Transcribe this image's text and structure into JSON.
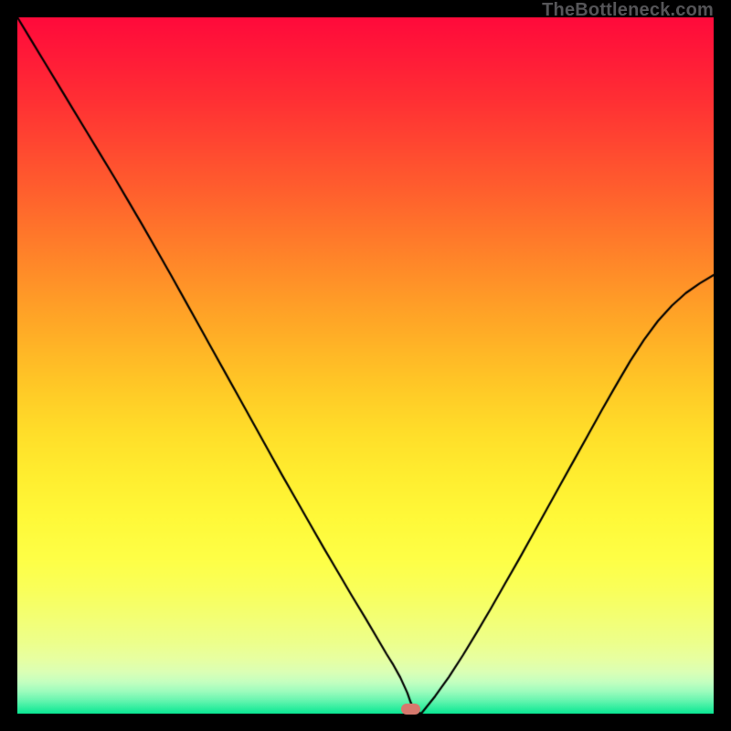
{
  "watermark": "TheBottleneck.com",
  "chart_data": {
    "type": "line",
    "title": "",
    "xlabel": "",
    "ylabel": "",
    "xlim": [
      0,
      100
    ],
    "ylim": [
      0,
      100
    ],
    "x": [
      0,
      2,
      4,
      6,
      8,
      10,
      12,
      14,
      16,
      18,
      20,
      22,
      24,
      26,
      28,
      30,
      32,
      34,
      36,
      38,
      40,
      42,
      44,
      46,
      48,
      50,
      52,
      53,
      54,
      55,
      56,
      56.5,
      57,
      58,
      60,
      62,
      64,
      66,
      68,
      70,
      72,
      74,
      76,
      78,
      80,
      82,
      84,
      86,
      88,
      90,
      92,
      94,
      96,
      98,
      100
    ],
    "values": [
      100,
      96.7,
      93.4,
      90.1,
      86.8,
      83.5,
      80.2,
      76.9,
      73.5,
      70.1,
      66.6,
      63.1,
      59.5,
      55.9,
      52.3,
      48.7,
      45.1,
      41.5,
      37.9,
      34.3,
      30.8,
      27.3,
      23.8,
      20.4,
      17.0,
      13.7,
      10.3,
      8.6,
      7.0,
      5.2,
      3.0,
      1.6,
      0.5,
      0,
      2.5,
      5.3,
      8.4,
      11.7,
      15.1,
      18.6,
      22.1,
      25.7,
      29.3,
      32.9,
      36.5,
      40.1,
      43.7,
      47.2,
      50.6,
      53.7,
      56.4,
      58.6,
      60.4,
      61.8,
      63.0
    ],
    "annotations": [
      {
        "type": "marker",
        "x_center": 56.5,
        "y": 0,
        "width_pct": 2.8,
        "color": "#d6786d"
      }
    ],
    "background_gradient": {
      "stops": [
        {
          "pos": 0.0,
          "color": "#ff0a3b"
        },
        {
          "pos": 0.06,
          "color": "#ff1c38"
        },
        {
          "pos": 0.12,
          "color": "#ff3034"
        },
        {
          "pos": 0.18,
          "color": "#ff4631"
        },
        {
          "pos": 0.24,
          "color": "#ff5c2e"
        },
        {
          "pos": 0.3,
          "color": "#ff732b"
        },
        {
          "pos": 0.36,
          "color": "#ff8a29"
        },
        {
          "pos": 0.42,
          "color": "#ffa127"
        },
        {
          "pos": 0.48,
          "color": "#ffb726"
        },
        {
          "pos": 0.54,
          "color": "#ffcc27"
        },
        {
          "pos": 0.6,
          "color": "#ffdf2a"
        },
        {
          "pos": 0.66,
          "color": "#ffee30"
        },
        {
          "pos": 0.72,
          "color": "#fff939"
        },
        {
          "pos": 0.78,
          "color": "#feff47"
        },
        {
          "pos": 0.825,
          "color": "#f9ff5c"
        },
        {
          "pos": 0.87,
          "color": "#f2ff79"
        },
        {
          "pos": 0.898,
          "color": "#edff8c"
        },
        {
          "pos": 0.92,
          "color": "#e8ffa0"
        },
        {
          "pos": 0.94,
          "color": "#dbffb5"
        },
        {
          "pos": 0.955,
          "color": "#c3ffc0"
        },
        {
          "pos": 0.968,
          "color": "#9dfcbd"
        },
        {
          "pos": 0.98,
          "color": "#6cf6b1"
        },
        {
          "pos": 0.99,
          "color": "#3aefa2"
        },
        {
          "pos": 1.0,
          "color": "#0ae793"
        }
      ]
    }
  }
}
